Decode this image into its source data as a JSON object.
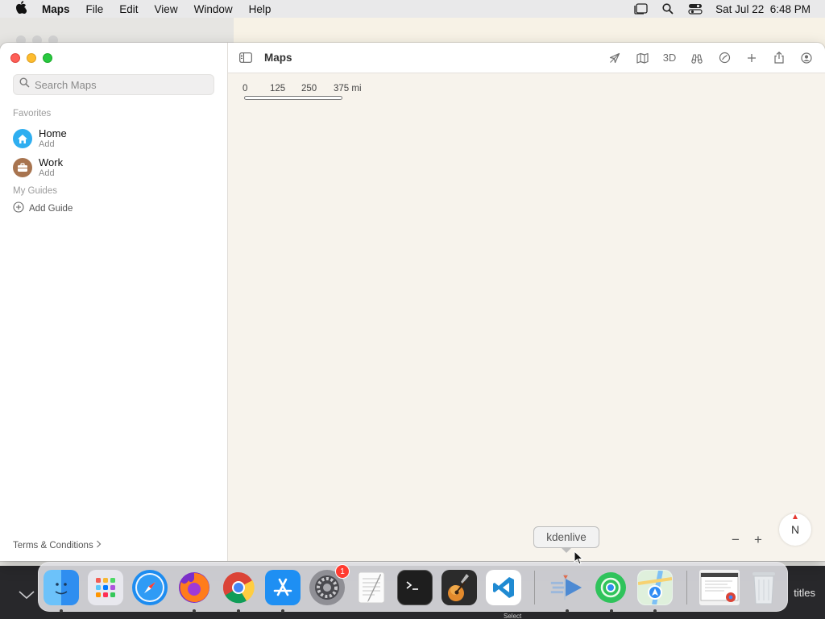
{
  "menubar": {
    "app_name": "Maps",
    "items": [
      "File",
      "Edit",
      "View",
      "Window",
      "Help"
    ],
    "clock": "Sat Jul 22  6:48 PM"
  },
  "sidebar": {
    "search_placeholder": "Search Maps",
    "favorites_title": "Favorites",
    "favorites": [
      {
        "name": "Home",
        "sub": "Add",
        "icon": "house-icon",
        "color": "#2eaef0"
      },
      {
        "name": "Work",
        "sub": "Add",
        "icon": "briefcase-icon",
        "color": "#a8744f"
      }
    ],
    "guides_title": "My Guides",
    "add_guide": "Add Guide",
    "terms": "Terms & Conditions"
  },
  "toolbar": {
    "title": "Maps",
    "tools": [
      "location-arrow-icon",
      "map-icon",
      "3D",
      "binoculars-icon",
      "look-around-icon",
      "plus-icon",
      "share-icon",
      "account-icon"
    ],
    "three_d": "3D"
  },
  "map": {
    "scale_labels": [
      "0",
      "125",
      "250",
      "375 mi"
    ],
    "compass": "N",
    "zoom_out": "−",
    "zoom_in": "+"
  },
  "dock": {
    "tooltip": "kdenlive",
    "apps": [
      {
        "name": "finder-icon",
        "color": "#2f8ef0",
        "running": true
      },
      {
        "name": "launchpad-icon",
        "color": "#e8e8ee",
        "running": false
      },
      {
        "name": "safari-icon",
        "color": "#1d8cf0",
        "running": false
      },
      {
        "name": "firefox-icon",
        "color": "#e2542a",
        "running": true
      },
      {
        "name": "chrome-icon",
        "color": "#ffffff",
        "running": true
      },
      {
        "name": "app-store-icon",
        "color": "#1e8ff3",
        "running": true
      },
      {
        "name": "system-settings-icon",
        "color": "#8f8f95",
        "running": false,
        "badge": "1"
      },
      {
        "name": "textedit-icon",
        "color": "#f7f7f7",
        "running": false
      },
      {
        "name": "terminal-icon",
        "color": "#1e1e1e",
        "running": false
      },
      {
        "name": "garageband-icon",
        "color": "#2b2b2b",
        "running": false
      },
      {
        "name": "vscode-icon",
        "color": "#ffffff",
        "running": false
      },
      {
        "name": "kdenlive-icon",
        "color": "#dfe6ef",
        "running": true
      },
      {
        "name": "find-my-icon",
        "color": "#25c04f",
        "running": true
      },
      {
        "name": "maps-icon",
        "color": "#e9f4ea",
        "running": true
      },
      {
        "name": "chrome-window-preview-icon",
        "color": "#f2f2f2",
        "running": false
      },
      {
        "name": "trash-icon",
        "color": "#e4e7ea",
        "running": false
      }
    ]
  },
  "background": {
    "bottom_right_text": "titles",
    "mini_label": "Select"
  }
}
